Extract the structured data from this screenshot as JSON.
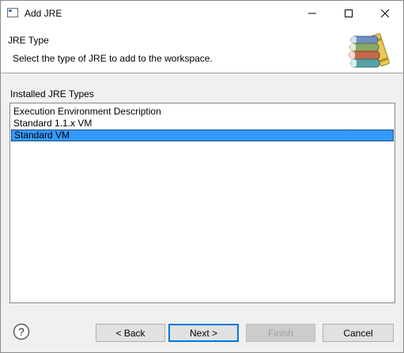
{
  "window": {
    "title": "Add JRE"
  },
  "titlebar": {
    "min_glyph": "—",
    "max_glyph": "☐",
    "close_glyph": "✕"
  },
  "header": {
    "title": "JRE Type",
    "description": "Select the type of JRE to add to the workspace.",
    "icon": "books-icon"
  },
  "group": {
    "label": "Installed JRE Types"
  },
  "list": {
    "items": [
      {
        "label": "Execution Environment Description",
        "selected": false
      },
      {
        "label": "Standard 1.1.x VM",
        "selected": false
      },
      {
        "label": "Standard VM",
        "selected": true
      }
    ]
  },
  "buttons": {
    "back": "< Back",
    "next": "Next >",
    "finish": "Finish",
    "cancel": "Cancel"
  },
  "colors": {
    "selection": "#3399ff",
    "default_button_border": "#0078d7"
  }
}
